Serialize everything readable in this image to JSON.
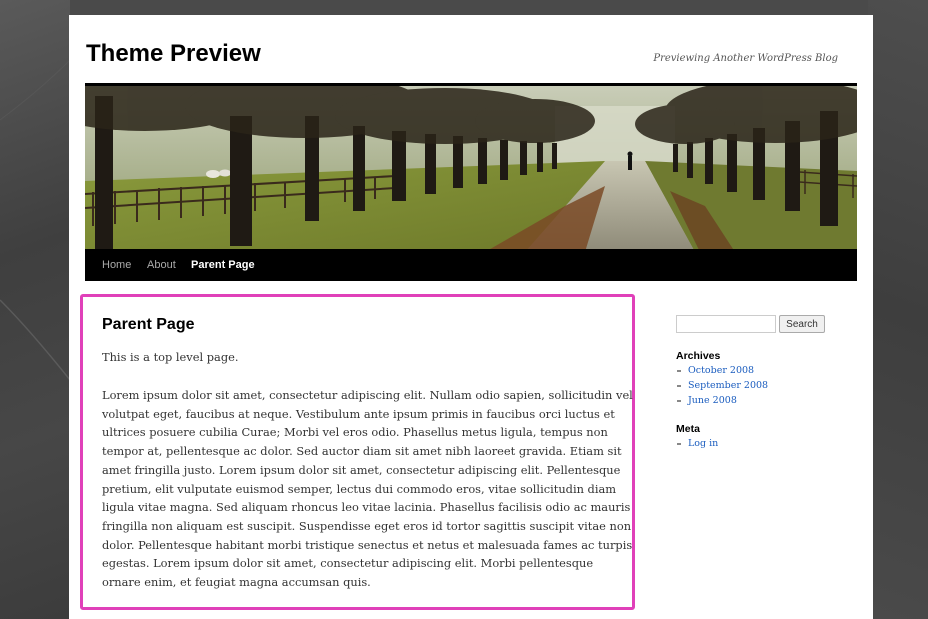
{
  "site": {
    "title": "Theme Preview",
    "description": "Previewing Another WordPress Blog"
  },
  "header_image": {
    "alt": "tree-lined avenue"
  },
  "nav": {
    "items": [
      {
        "label": "Home",
        "current": false
      },
      {
        "label": "About",
        "current": false
      },
      {
        "label": "Parent Page",
        "current": true
      }
    ]
  },
  "page": {
    "title": "Parent Page",
    "intro": "This is a top level page.",
    "body": "Lorem ipsum dolor sit amet, consectetur adipiscing elit. Nullam odio sapien, sollicitudin vel volutpat eget, faucibus at neque. Vestibulum ante ipsum primis in faucibus orci luctus et ultrices posuere cubilia Curae; Morbi vel eros odio. Phasellus metus ligula, tempus non tempor at, pellentesque ac dolor. Sed auctor diam sit amet nibh laoreet gravida. Etiam sit amet fringilla justo. Lorem ipsum dolor sit amet, consectetur adipiscing elit. Pellentesque pretium, elit vulputate euismod semper, lectus dui commodo eros, vitae sollicitudin diam ligula vitae magna. Sed aliquam rhoncus leo vitae lacinia. Phasellus facilisis odio ac mauris fringilla non aliquam est suscipit. Suspendisse eget eros id tortor sagittis suscipit vitae non dolor. Pellentesque habitant morbi tristique senectus et netus et malesuada fames ac turpis egestas. Lorem ipsum dolor sit amet, consectetur adipiscing elit. Morbi pellentesque ornare enim, et feugiat magna accumsan quis."
  },
  "sidebar": {
    "search": {
      "value": "",
      "button_label": "Search"
    },
    "archives": {
      "title": "Archives",
      "items": [
        "October 2008",
        "September 2008",
        "June 2008"
      ]
    },
    "meta": {
      "title": "Meta",
      "items": [
        "Log in"
      ]
    }
  },
  "colors": {
    "highlight_border": "#e040b9",
    "link": "#1b5dbf",
    "nav_background": "#000000",
    "outer_background": "#4a4a4a"
  }
}
